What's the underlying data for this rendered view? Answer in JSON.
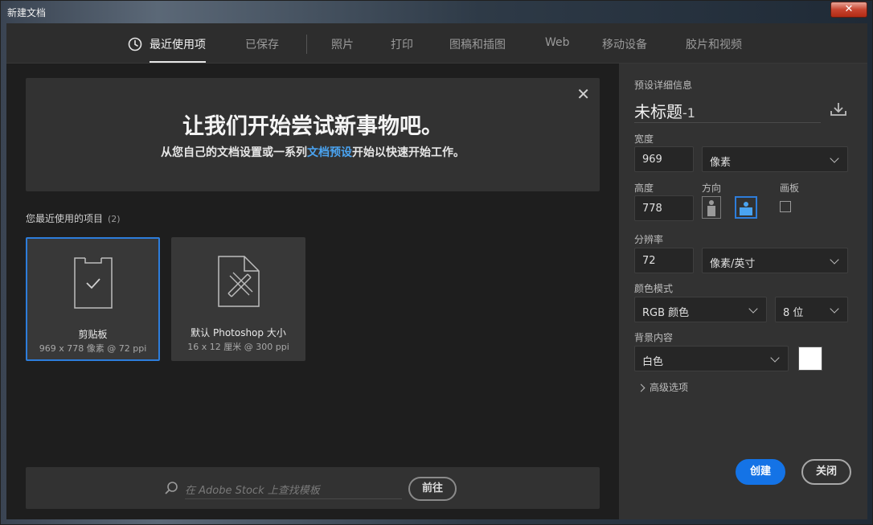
{
  "window": {
    "title": "新建文档",
    "close_label": "✕"
  },
  "tabs": [
    {
      "label": "最近使用项",
      "active": true,
      "icon": "clock-icon"
    },
    {
      "label": "已保存",
      "active": false
    },
    {
      "label": "照片",
      "active": false
    },
    {
      "label": "打印",
      "active": false
    },
    {
      "label": "图稿和插图",
      "active": false
    },
    {
      "label": "Web",
      "active": false
    },
    {
      "label": "移动设备",
      "active": false
    },
    {
      "label": "胶片和视频",
      "active": false
    }
  ],
  "hero": {
    "title": "让我们开始尝试新事物吧。",
    "subtitle_pre": "从您自己的文档设置或一系列",
    "subtitle_link": "文档预设",
    "subtitle_post": "开始以快速开始工作。",
    "close_icon": "close-icon"
  },
  "recent": {
    "label": "您最近使用的项目",
    "count": "(2)",
    "items": [
      {
        "name": "剪贴板",
        "meta": "969 x 778 像素 @ 72 ppi",
        "icon": "clipboard-icon",
        "selected": true
      },
      {
        "name": "默认 Photoshop 大小",
        "meta": "16 x 12 厘米 @ 300 ppi",
        "icon": "document-ruler-icon",
        "selected": false
      }
    ]
  },
  "stock": {
    "placeholder": "在 Adobe Stock 上查找模板",
    "go_label": "前往"
  },
  "preset": {
    "section_label": "预设详细信息",
    "doc_name": "未标题",
    "doc_suffix": "-1",
    "width_label": "宽度",
    "width_value": "969",
    "width_unit": "像素",
    "height_label": "高度",
    "height_value": "778",
    "orientation_label": "方向",
    "artboard_label": "画板",
    "resolution_label": "分辨率",
    "resolution_value": "72",
    "resolution_unit": "像素/英寸",
    "color_mode_label": "颜色模式",
    "color_mode_value": "RGB 颜色",
    "bit_depth_value": "8 位",
    "background_label": "背景内容",
    "background_value": "白色",
    "background_color": "#ffffff",
    "advanced_label": "高级选项"
  },
  "buttons": {
    "create_label": "创建",
    "close_label": "关闭"
  },
  "colors": {
    "accent": "#1473e6",
    "link": "#4aa3f0",
    "panel": "#323232",
    "bg": "#1e1e1e"
  }
}
